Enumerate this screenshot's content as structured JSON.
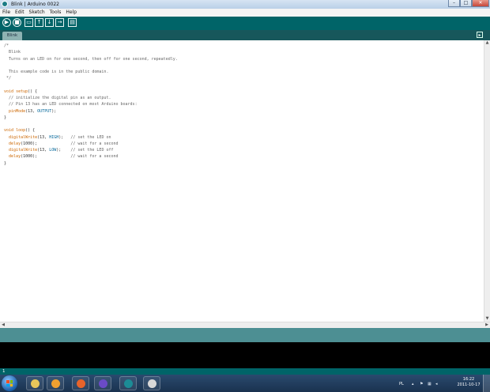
{
  "window": {
    "title": "Blink | Arduino 0022"
  },
  "menu": [
    "File",
    "Edit",
    "Sketch",
    "Tools",
    "Help"
  ],
  "toolbar_buttons": [
    {
      "name": "verify",
      "glyph": "▶",
      "icon": "play-icon"
    },
    {
      "name": "stop",
      "glyph": "■",
      "icon": "stop-icon"
    },
    {
      "name": "new",
      "glyph": "▭",
      "icon": "new-file-icon"
    },
    {
      "name": "open",
      "glyph": "↑",
      "icon": "open-icon"
    },
    {
      "name": "save",
      "glyph": "↓",
      "icon": "save-icon"
    },
    {
      "name": "upload",
      "glyph": "→",
      "icon": "upload-icon"
    },
    {
      "name": "serial-monitor",
      "glyph": "▤",
      "icon": "serial-monitor-icon"
    }
  ],
  "tab": {
    "label": "Blink"
  },
  "code_lines": [
    [
      {
        "t": "/*",
        "c": "cm"
      }
    ],
    [
      {
        "t": "  Blink",
        "c": "cm"
      }
    ],
    [
      {
        "t": "  Turns on an LED on for one second, then off for one second, repeatedly.",
        "c": "cm"
      }
    ],
    [],
    [
      {
        "t": "  This example code is in the public domain.",
        "c": "cm"
      }
    ],
    [
      {
        "t": " */",
        "c": "cm"
      }
    ],
    [],
    [
      {
        "t": "void",
        "c": "kw"
      },
      {
        "t": " ",
        "c": "txt"
      },
      {
        "t": "setup",
        "c": "fn"
      },
      {
        "t": "() {",
        "c": "txt"
      }
    ],
    [
      {
        "t": "  // initialize the digital pin as an output.",
        "c": "cm"
      }
    ],
    [
      {
        "t": "  // Pin 13 has an LED connected on most Arduino boards:",
        "c": "cm"
      }
    ],
    [
      {
        "t": "  ",
        "c": "txt"
      },
      {
        "t": "pinMode",
        "c": "fn"
      },
      {
        "t": "(13, ",
        "c": "txt"
      },
      {
        "t": "OUTPUT",
        "c": "const"
      },
      {
        "t": ");",
        "c": "txt"
      }
    ],
    [
      {
        "t": "}",
        "c": "txt"
      }
    ],
    [],
    [
      {
        "t": "void",
        "c": "kw"
      },
      {
        "t": " ",
        "c": "txt"
      },
      {
        "t": "loop",
        "c": "fn"
      },
      {
        "t": "() {",
        "c": "txt"
      }
    ],
    [
      {
        "t": "  ",
        "c": "txt"
      },
      {
        "t": "digitalWrite",
        "c": "fn"
      },
      {
        "t": "(13, ",
        "c": "txt"
      },
      {
        "t": "HIGH",
        "c": "const"
      },
      {
        "t": ");   ",
        "c": "txt"
      },
      {
        "t": "// set the LED on",
        "c": "cm"
      }
    ],
    [
      {
        "t": "  ",
        "c": "txt"
      },
      {
        "t": "delay",
        "c": "fn"
      },
      {
        "t": "(1000);              ",
        "c": "txt"
      },
      {
        "t": "// wait for a second",
        "c": "cm"
      }
    ],
    [
      {
        "t": "  ",
        "c": "txt"
      },
      {
        "t": "digitalWrite",
        "c": "fn"
      },
      {
        "t": "(13, ",
        "c": "txt"
      },
      {
        "t": "LOW",
        "c": "const"
      },
      {
        "t": ");    ",
        "c": "txt"
      },
      {
        "t": "// set the LED off",
        "c": "cm"
      }
    ],
    [
      {
        "t": "  ",
        "c": "txt"
      },
      {
        "t": "delay",
        "c": "fn"
      },
      {
        "t": "(1000);              ",
        "c": "txt"
      },
      {
        "t": "// wait for a second",
        "c": "cm"
      }
    ],
    [
      {
        "t": "}",
        "c": "txt"
      }
    ]
  ],
  "line_number": "1",
  "taskbar": {
    "apps": [
      {
        "name": "windows-explorer",
        "icon": "folder-icon",
        "color": "#e8c65a"
      },
      {
        "name": "media-player",
        "icon": "media-player-icon",
        "color": "#f0a030"
      },
      {
        "name": "firefox",
        "icon": "firefox-icon",
        "color": "#e8632a"
      },
      {
        "name": "app-waves",
        "icon": "waves-icon",
        "color": "#6a4bc7"
      },
      {
        "name": "arduino",
        "icon": "arduino-icon",
        "color": "#1c8c96"
      },
      {
        "name": "paint",
        "icon": "paint-icon",
        "color": "#d8d8d8"
      }
    ],
    "language": "PL",
    "time": "16:22",
    "date": "2011-10-17"
  },
  "colors": {
    "toolbar": "#006468",
    "tabbar": "#17575b",
    "status": "#4d8f93",
    "console": "#000000",
    "keyword": "#cc6600",
    "constant": "#006699",
    "comment": "#666666"
  }
}
